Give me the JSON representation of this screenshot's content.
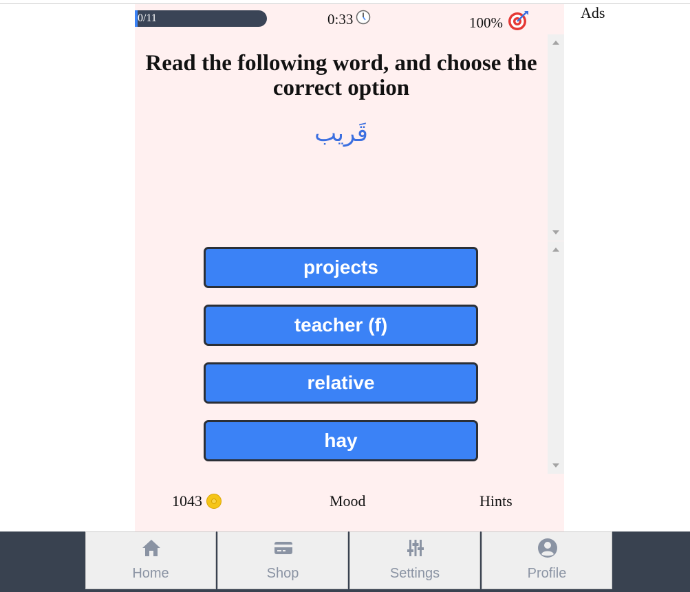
{
  "status": {
    "progress_label": "0/11",
    "progress_fraction": 0.0,
    "timer": "0:33",
    "timer_icon": "clock-icon",
    "accuracy": "100%",
    "accuracy_icon": "target-icon"
  },
  "ads_label": "Ads",
  "question": {
    "prompt": "Read the following word, and choose the correct option",
    "word": "قَريب"
  },
  "options": [
    "projects",
    "teacher (f)",
    "relative",
    "hay"
  ],
  "footer": {
    "coins": "1043",
    "coin_icon": "coin-icon",
    "mood": "Mood",
    "hints": "Hints"
  },
  "nav": {
    "items": [
      {
        "label": "Home",
        "icon": "home-icon"
      },
      {
        "label": "Shop",
        "icon": "card-icon"
      },
      {
        "label": "Settings",
        "icon": "sliders-icon"
      },
      {
        "label": "Profile",
        "icon": "user-circle-icon"
      }
    ]
  },
  "colors": {
    "accent": "#3b82f6",
    "app_background": "#fff0f0",
    "navbar": "#394250",
    "progress_track": "#3a4456"
  }
}
